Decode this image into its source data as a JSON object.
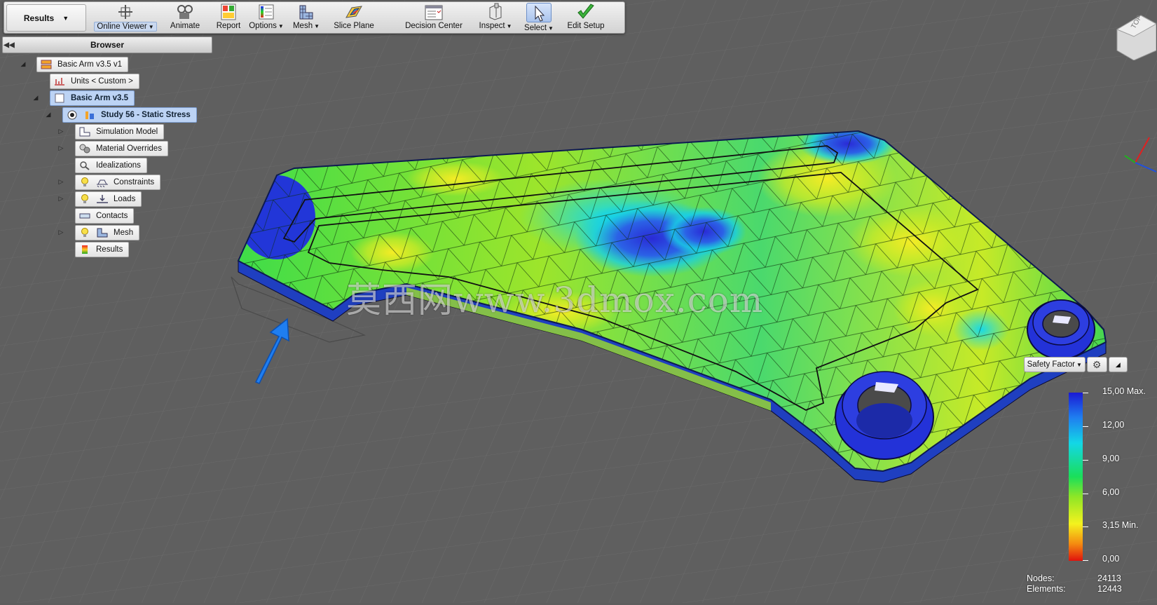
{
  "toolbar": {
    "results_label": "Results",
    "buttons": [
      {
        "label": "Online Viewer",
        "icon": "online-viewer-icon",
        "dropdown": true
      },
      {
        "label": "Animate",
        "icon": "animate-icon"
      },
      {
        "label": "Report",
        "icon": "report-icon"
      },
      {
        "label": "Options",
        "icon": "options-icon",
        "dropdown": true
      },
      {
        "label": "Mesh",
        "icon": "mesh-icon",
        "dropdown": true
      },
      {
        "label": "Slice Plane",
        "icon": "slice-plane-icon"
      },
      {
        "label": "Decision Center",
        "icon": "decision-center-icon"
      },
      {
        "label": "Inspect",
        "icon": "inspect-icon",
        "dropdown": true
      },
      {
        "label": "Select",
        "icon": "select-cursor-icon",
        "dropdown": true
      },
      {
        "label": "Edit Setup",
        "icon": "checkmark-icon"
      }
    ]
  },
  "browser": {
    "title": "Browser",
    "nodes": [
      {
        "label": "Basic Arm v3.5 v1"
      },
      {
        "label": "Units < Custom >"
      },
      {
        "label": "Basic Arm v3.5"
      },
      {
        "label": "Study 56 - Static Stress"
      },
      {
        "label": "Simulation Model"
      },
      {
        "label": "Material Overrides"
      },
      {
        "label": "Idealizations"
      },
      {
        "label": "Constraints"
      },
      {
        "label": "Loads"
      },
      {
        "label": "Contacts"
      },
      {
        "label": "Mesh"
      },
      {
        "label": "Results"
      }
    ]
  },
  "viewcube": {
    "face": "TOP"
  },
  "watermark": "莫西网www.3dmox.com",
  "result_panel": {
    "dropdown_label": "Safety Factor",
    "legend": {
      "max_label": "15,00 Max.",
      "ticks": [
        "12,00",
        "9,00",
        "6,00"
      ],
      "min_label": "3,15 Min.",
      "zero_label": "0,00"
    },
    "stats": {
      "nodes_label": "Nodes:",
      "nodes_value": "24113",
      "elements_label": "Elements:",
      "elements_value": "12443"
    }
  },
  "colors": {
    "viewport_bg": "#5d5d5d",
    "grid_line": "#6e6e6e",
    "highlight": "#bcd3f4",
    "legend_max": "#1a1ad4",
    "legend_min": "#e0130d"
  }
}
